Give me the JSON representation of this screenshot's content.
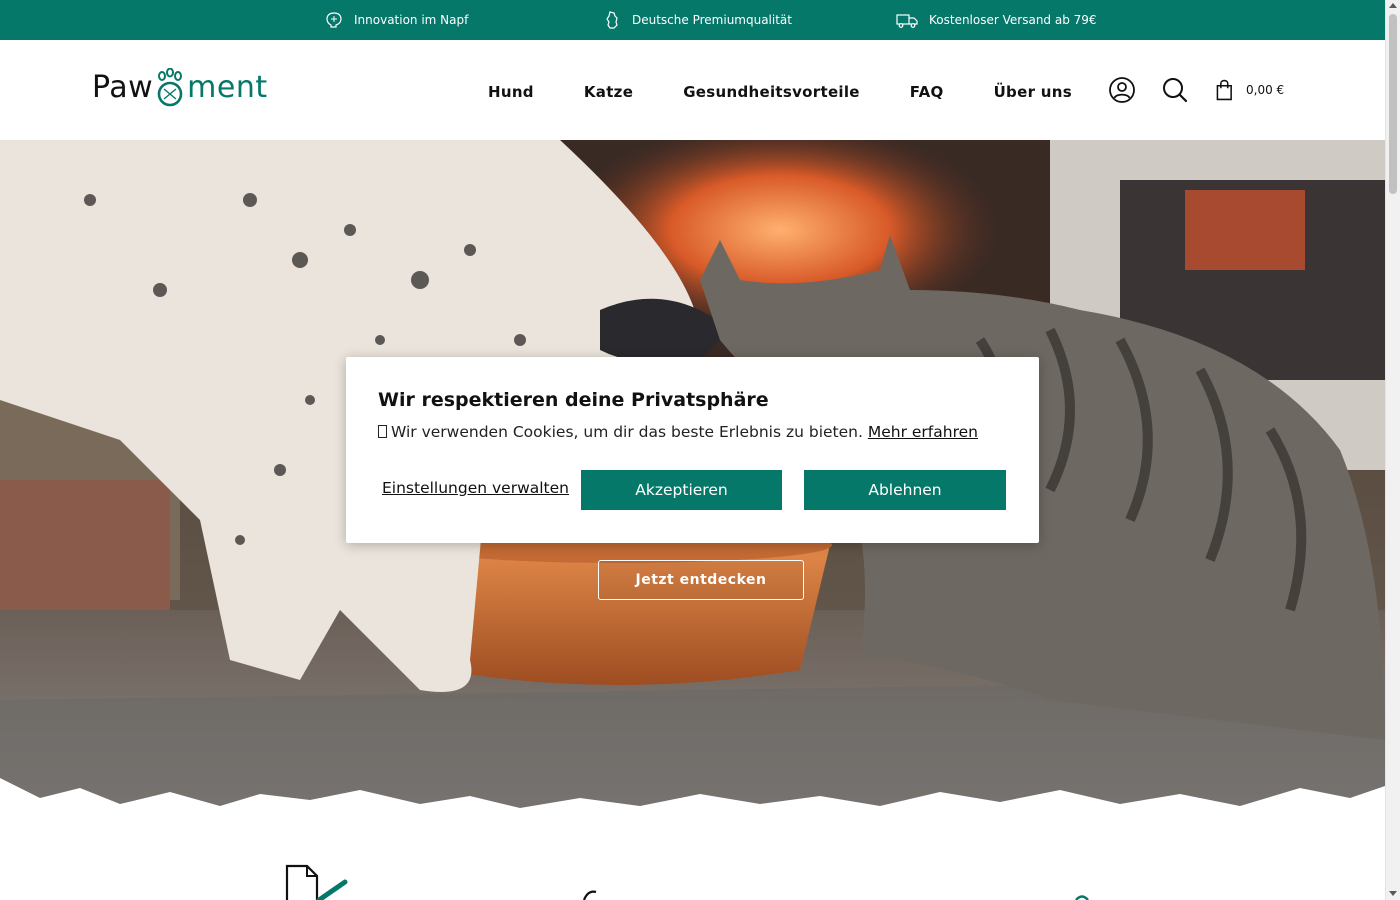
{
  "topbar": {
    "items": [
      {
        "icon": "brain-icon",
        "label": "Innovation im Napf"
      },
      {
        "icon": "germany-icon",
        "label": "Deutsche Premiumqualität"
      },
      {
        "icon": "truck-icon",
        "label": "Kostenloser Versand ab 79€"
      }
    ]
  },
  "header": {
    "logo": {
      "part1": "Paw",
      "part2": "ment"
    },
    "nav": [
      "Hund",
      "Katze",
      "Gesundheitsvorteile",
      "FAQ",
      "Über uns"
    ],
    "icons": [
      "account-icon",
      "search-icon",
      "cart-icon"
    ],
    "cart_total": "0,00 €"
  },
  "hero": {
    "cta_label": "Jetzt entdecken"
  },
  "cookie": {
    "title": "Wir respektieren deine Privatsphäre",
    "text": "Wir verwenden Cookies, um dir das beste Erlebnis zu bieten.",
    "learn_more": "Mehr erfahren",
    "settings": "Einstellungen verwalten",
    "accept": "Akzeptieren",
    "decline": "Ablehnen"
  },
  "colors": {
    "brand": "#05786a",
    "text": "#111111",
    "background": "#ffffff"
  }
}
